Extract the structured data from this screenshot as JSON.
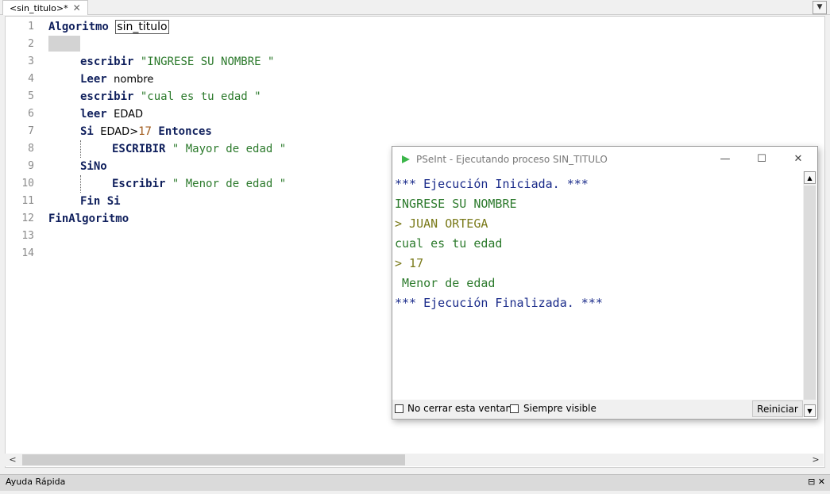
{
  "tab": {
    "label": "<sin_titulo>*",
    "close": "✕"
  },
  "line_numbers": [
    "1",
    "2",
    "3",
    "4",
    "5",
    "6",
    "7",
    "8",
    "9",
    "10",
    "11",
    "12",
    "13",
    "14"
  ],
  "code": {
    "l1_kw": "Algoritmo",
    "l1_name": "sin_titulo",
    "l3_kw": "escribir",
    "l3_str": "\"INGRESE SU NOMBRE \"",
    "l4_kw": "Leer",
    "l4_id": "nombre",
    "l5_kw": "escribir",
    "l5_str": "\"cual es tu edad \"",
    "l6_kw": "leer",
    "l6_id": "EDAD",
    "l7_kw": "Si",
    "l7_id": "EDAD>",
    "l7_num": "17",
    "l7_kw2": "Entonces",
    "l8_kw": "ESCRIBIR",
    "l8_str": "\" Mayor de edad \"",
    "l9_kw": "SiNo",
    "l10_kw": "Escribir",
    "l10_str": "\" Menor de edad \"",
    "l11_kw": "Fin Si",
    "l12_kw": "FinAlgoritmo"
  },
  "help_panel": {
    "title": "Ayuda Rápida",
    "icons": "⊟ ✕"
  },
  "console": {
    "title": "PSeInt - Ejecutando proceso SIN_TITULO",
    "lines": [
      "*** Ejecución Iniciada. ***",
      "INGRESE SU NOMBRE",
      "> JUAN ORTEGA",
      "cual es tu edad",
      "> 17",
      " Menor de edad",
      "*** Ejecución Finalizada. ***"
    ],
    "no_close_label": "No cerrar esta ventana",
    "always_visible_label": "Siempre visible",
    "restart_label": "Reiniciar",
    "logo_color": "#3cb64a"
  }
}
